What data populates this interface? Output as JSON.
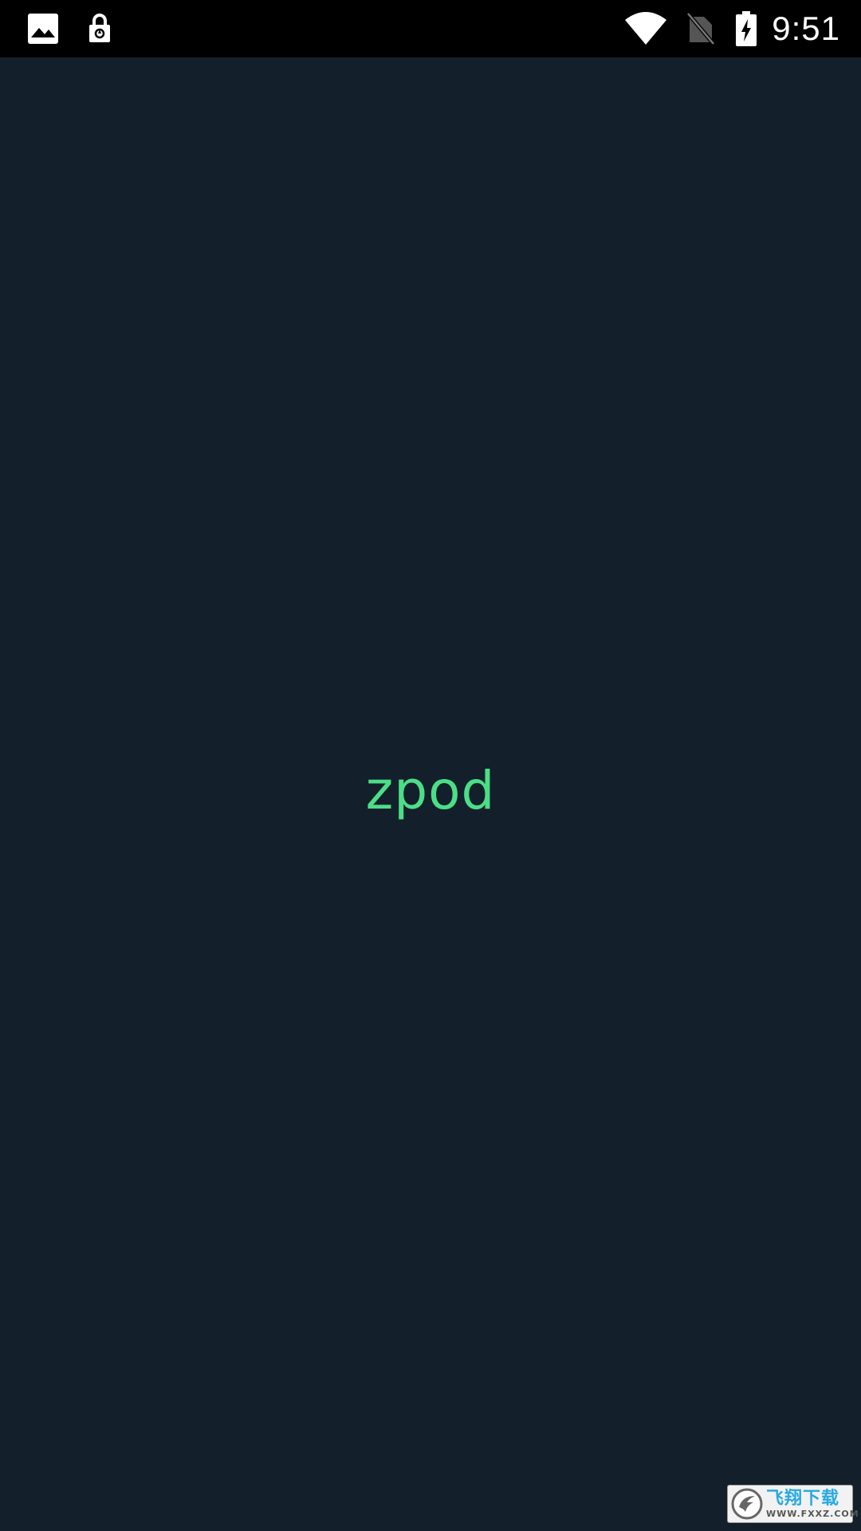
{
  "status_bar": {
    "time": "9:51",
    "icons": [
      "gallery-icon",
      "lock-icon",
      "wifi-icon",
      "no-sim-icon",
      "battery-charging-icon"
    ]
  },
  "splash": {
    "title": "zpod",
    "title_color": "#4cde86",
    "background_color": "#13202b"
  },
  "watermark": {
    "name": "飞翔下载",
    "url": "WWW.FXXZ.COM"
  }
}
